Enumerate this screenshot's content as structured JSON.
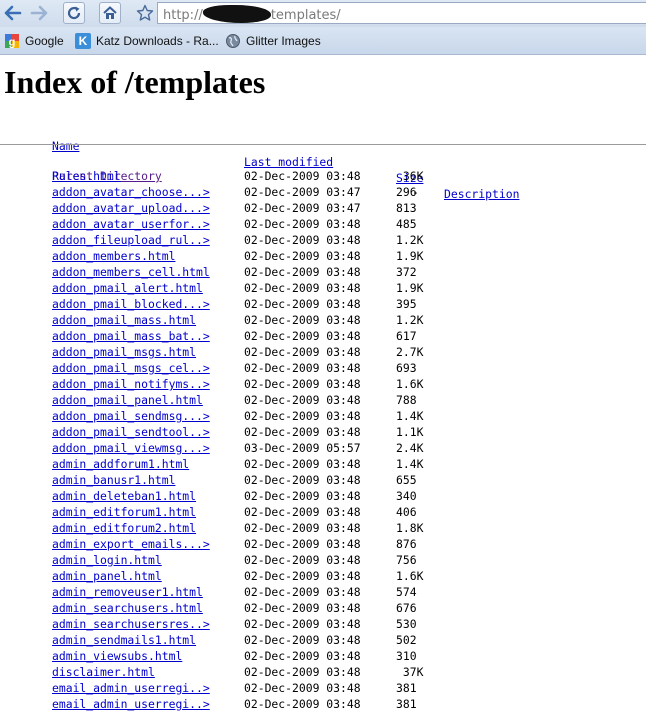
{
  "browser": {
    "url_prefix": "http://",
    "url_suffix": "templates/",
    "bookmarks": [
      {
        "label": "Google",
        "icon": "google-icon"
      },
      {
        "label": "Katz Downloads - Ra...",
        "icon": "katz-icon",
        "icon_letter": "K"
      },
      {
        "label": "Glitter Images",
        "icon": "globe-icon"
      }
    ]
  },
  "page": {
    "title": "Index of /templates",
    "headers": {
      "name": "Name",
      "last_modified": "Last modified",
      "size": "Size",
      "description": "Description"
    },
    "parent": {
      "name": "Parent Directory",
      "size": "-"
    },
    "files": [
      {
        "name": "Rules.html",
        "date": "02-Dec-2009 03:48",
        "size": " 36K"
      },
      {
        "name": "addon_avatar_choose...>",
        "date": "02-Dec-2009 03:47",
        "size": "296"
      },
      {
        "name": "addon_avatar_upload...>",
        "date": "02-Dec-2009 03:47",
        "size": "813"
      },
      {
        "name": "addon_avatar_userfor..>",
        "date": "02-Dec-2009 03:48",
        "size": "485"
      },
      {
        "name": "addon_fileupload_rul..>",
        "date": "02-Dec-2009 03:48",
        "size": "1.2K"
      },
      {
        "name": "addon_members.html",
        "date": "02-Dec-2009 03:48",
        "size": "1.9K"
      },
      {
        "name": "addon_members_cell.html",
        "date": "02-Dec-2009 03:48",
        "size": "372"
      },
      {
        "name": "addon_pmail_alert.html",
        "date": "02-Dec-2009 03:48",
        "size": "1.9K"
      },
      {
        "name": "addon_pmail_blocked...>",
        "date": "02-Dec-2009 03:48",
        "size": "395"
      },
      {
        "name": "addon_pmail_mass.html",
        "date": "02-Dec-2009 03:48",
        "size": "1.2K"
      },
      {
        "name": "addon_pmail_mass_bat..>",
        "date": "02-Dec-2009 03:48",
        "size": "617"
      },
      {
        "name": "addon_pmail_msgs.html",
        "date": "02-Dec-2009 03:48",
        "size": "2.7K"
      },
      {
        "name": "addon_pmail_msgs_cel..>",
        "date": "02-Dec-2009 03:48",
        "size": "693"
      },
      {
        "name": "addon_pmail_notifyms..>",
        "date": "02-Dec-2009 03:48",
        "size": "1.6K"
      },
      {
        "name": "addon_pmail_panel.html",
        "date": "02-Dec-2009 03:48",
        "size": "788"
      },
      {
        "name": "addon_pmail_sendmsg...>",
        "date": "02-Dec-2009 03:48",
        "size": "1.4K"
      },
      {
        "name": "addon_pmail_sendtool..>",
        "date": "02-Dec-2009 03:48",
        "size": "1.1K"
      },
      {
        "name": "addon_pmail_viewmsg...>",
        "date": "03-Dec-2009 05:57",
        "size": "2.4K"
      },
      {
        "name": "admin_addforum1.html",
        "date": "02-Dec-2009 03:48",
        "size": "1.4K"
      },
      {
        "name": "admin_banusr1.html",
        "date": "02-Dec-2009 03:48",
        "size": "655"
      },
      {
        "name": "admin_deleteban1.html",
        "date": "02-Dec-2009 03:48",
        "size": "340"
      },
      {
        "name": "admin_editforum1.html",
        "date": "02-Dec-2009 03:48",
        "size": "406"
      },
      {
        "name": "admin_editforum2.html",
        "date": "02-Dec-2009 03:48",
        "size": "1.8K"
      },
      {
        "name": "admin_export_emails...>",
        "date": "02-Dec-2009 03:48",
        "size": "876"
      },
      {
        "name": "admin_login.html",
        "date": "02-Dec-2009 03:48",
        "size": "756"
      },
      {
        "name": "admin_panel.html",
        "date": "02-Dec-2009 03:48",
        "size": "1.6K"
      },
      {
        "name": "admin_removeuser1.html",
        "date": "02-Dec-2009 03:48",
        "size": "574"
      },
      {
        "name": "admin_searchusers.html",
        "date": "02-Dec-2009 03:48",
        "size": "676"
      },
      {
        "name": "admin_searchusersres..>",
        "date": "02-Dec-2009 03:48",
        "size": "530"
      },
      {
        "name": "admin_sendmails1.html",
        "date": "02-Dec-2009 03:48",
        "size": "502"
      },
      {
        "name": "admin_viewsubs.html",
        "date": "02-Dec-2009 03:48",
        "size": "310"
      },
      {
        "name": "disclaimer.html",
        "date": "02-Dec-2009 03:48",
        "size": " 37K"
      },
      {
        "name": "email_admin_userregi..>",
        "date": "02-Dec-2009 03:48",
        "size": "381"
      },
      {
        "name": "email_admin_userregi..>",
        "date": "02-Dec-2009 03:48",
        "size": "381"
      }
    ]
  }
}
